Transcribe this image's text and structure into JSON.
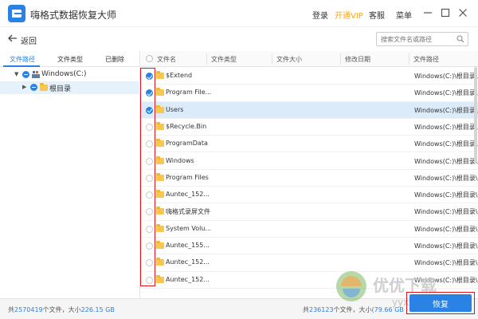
{
  "app": {
    "title": "嗨格式数据恢复大师",
    "login": "登录",
    "vip": "开通VIP",
    "service": "客服",
    "menu": "菜单"
  },
  "nav": {
    "back": "返回",
    "search_placeholder": "搜索文件名或路径"
  },
  "left_tabs": [
    {
      "label": "文件路径",
      "active": true
    },
    {
      "label": "文件类型",
      "active": false
    },
    {
      "label": "已删除",
      "active": false
    }
  ],
  "tree": [
    {
      "label": "Windows(C:)",
      "level": 0
    },
    {
      "label": "根目录",
      "level": 1,
      "selected": true
    }
  ],
  "table": {
    "columns": [
      "文件名",
      "文件类型",
      "文件大小",
      "修改日期",
      "文件路径"
    ],
    "rows": [
      {
        "name": "$Extend",
        "path": "Windows(C:)\\根目录\\",
        "checked": true,
        "selected": false
      },
      {
        "name": "Program File...",
        "path": "Windows(C:)\\根目录\\",
        "checked": true,
        "selected": false
      },
      {
        "name": "Users",
        "path": "Windows(C:)\\根目录\\",
        "checked": true,
        "selected": true
      },
      {
        "name": "$Recycle.Bin",
        "path": "Windows(C:)\\根目录\\",
        "checked": false,
        "selected": false
      },
      {
        "name": "ProgramData",
        "path": "Windows(C:)\\根目录\\",
        "checked": false,
        "selected": false
      },
      {
        "name": "Windows",
        "path": "Windows(C:)\\根目录\\",
        "checked": false,
        "selected": false
      },
      {
        "name": "Program Files",
        "path": "Windows(C:)\\根目录\\",
        "checked": false,
        "selected": false
      },
      {
        "name": "Auntec_152...",
        "path": "Windows(C:)\\根目录\\",
        "checked": false,
        "selected": false
      },
      {
        "name": "嗨格式录屏文件",
        "path": "Windows(C:)\\根目录\\",
        "checked": false,
        "selected": false
      },
      {
        "name": "System Volu...",
        "path": "Windows(C:)\\根目录\\",
        "checked": false,
        "selected": false
      },
      {
        "name": "Auntec_155...",
        "path": "Windows(C:)\\根目录\\",
        "checked": false,
        "selected": false
      },
      {
        "name": "Auntec_152...",
        "path": "Windows(C:)\\根目录\\",
        "checked": false,
        "selected": false
      },
      {
        "name": "Auntec_152...",
        "path": "Windows(C:)\\根目录\\",
        "checked": false,
        "selected": false
      }
    ]
  },
  "status": {
    "total_prefix": "共",
    "total_count": "2570419",
    "total_mid": "个文件，大小",
    "total_size": "226.15 GB",
    "sel_prefix": "共",
    "sel_count": "236123",
    "sel_mid": "个文件，大小",
    "sel_size": "(79.66 GB",
    "recover": "恢复"
  },
  "watermark": {
    "text": "优优下载",
    "sub": "yyxt.com"
  },
  "colors": {
    "accent": "#2a82e4",
    "vip": "#f5a623",
    "annotation": "#e0141e"
  }
}
